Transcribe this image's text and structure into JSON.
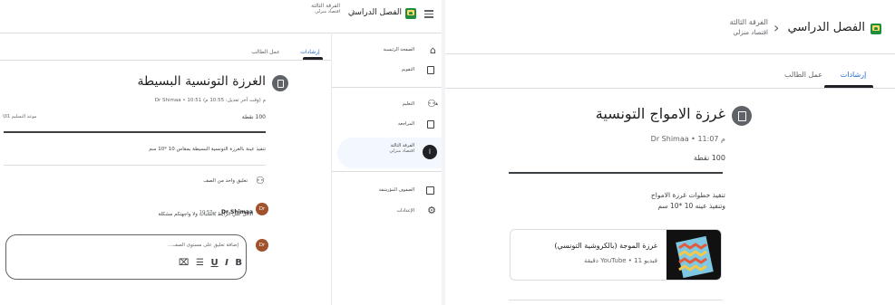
{
  "left": {
    "header": {
      "menu_icon": "hamburger-menu-icon",
      "title": "الفصل الدراسي",
      "sub_title": "الفرقة الثالثة",
      "sub_subtitle": "اقتصاد منزلي"
    },
    "tabs": {
      "instructions": "إرشادات",
      "student_work": "عمل الطالب"
    },
    "sidebar": {
      "items": [
        {
          "label": "الصفحة الرئيسية",
          "icon": "home-icon"
        },
        {
          "label": "التقويم",
          "icon": "calendar-icon"
        },
        {
          "label": "التعليم",
          "icon": "people-icon"
        },
        {
          "label": "المراجعة",
          "icon": "review-icon"
        },
        {
          "label": "الفرقة الثالثة",
          "sub": "اقتصاد منزلي",
          "avatar": "ا"
        },
        {
          "label": "الصفوف المؤرشفة",
          "icon": "archive-icon"
        },
        {
          "label": "الإعدادات",
          "icon": "gear-icon"
        }
      ]
    },
    "assignment": {
      "title": "الغرزة التونسية البسيطة",
      "meta": "Dr Shimaa • 10:51 م (وقت آخر تعديل: 10:55 م)",
      "points": "100 نقطة",
      "due": "موعد التسليم 01\\",
      "description": "تنفيذ عينة بالغرزة التونسية البسيطة بمقاس 10 *10 سم"
    },
    "comments": {
      "heading": "تعليق واحد من الصف",
      "author": "Dr Shimaa",
      "time": "10:57 م",
      "text": "ادخل علي الرابط بالشباب ولا واجهتكم مشكلة",
      "avatar": "Dr",
      "compose_placeholder": "إضافة تعليق على مستوى الصف...",
      "compose_avatar": "Dr",
      "format_buttons": [
        "B",
        "I",
        "U",
        "☰",
        "⌧"
      ]
    }
  },
  "right": {
    "header": {
      "title": "الفصل الدراسي",
      "sub_title": "الفرقة الثالثة",
      "sub_subtitle": "اقتصاد منزلي"
    },
    "tabs": {
      "instructions": "إرشادات",
      "student_work": "عمل الطالب"
    },
    "assignment": {
      "title": "غرزة الامواج التونسية",
      "meta": "Dr Shimaa • 11:07 م",
      "points": "100 نقطة",
      "description_line1": "تنفيذ خطوات غرزة الامواج",
      "description_line2": "وتنفيذ عينه 10 *10 سم"
    },
    "attachment": {
      "title": "غرزة الموجة (بالكروشية التونسي)",
      "subtitle": "فيديو YouTube • 11 دقيقة"
    }
  }
}
